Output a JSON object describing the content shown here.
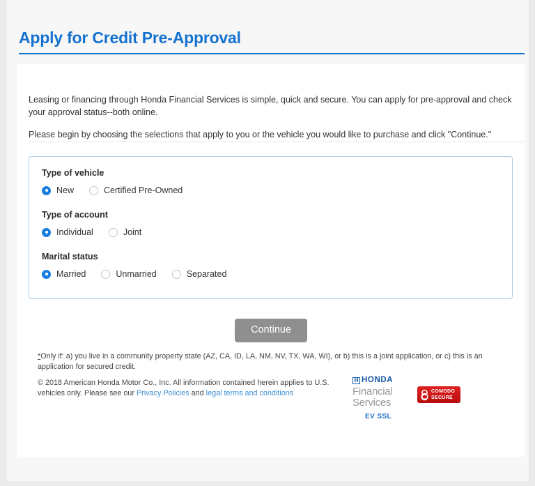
{
  "header": {
    "title": "Apply for Credit Pre-Approval"
  },
  "intro": {
    "paragraph_1": "Leasing or financing through Honda Financial Services is simple, quick and secure. You can apply for pre-approval and check your approval status--both online.",
    "paragraph_2": "Please begin by choosing the selections that apply to you or the vehicle you would like to purchase and click \"Continue.\""
  },
  "form": {
    "groups": [
      {
        "label": "Type of vehicle",
        "name": "type-of-vehicle",
        "options": [
          {
            "label": "New",
            "selected": true
          },
          {
            "label": "Certified Pre-Owned",
            "selected": false
          }
        ]
      },
      {
        "label": "Type of account",
        "name": "type-of-account",
        "options": [
          {
            "label": "Individual",
            "selected": true
          },
          {
            "label": "Joint",
            "selected": false
          }
        ]
      },
      {
        "label": "Marital status",
        "name": "marital-status",
        "options": [
          {
            "label": "Married",
            "selected": true
          },
          {
            "label": "Unmarried",
            "selected": false
          },
          {
            "label": "Separated",
            "selected": false
          }
        ]
      }
    ],
    "continue_label": "Continue"
  },
  "footer": {
    "footnote_star": "*",
    "footnote": "Only if: a) you live in a community property state (AZ, CA, ID, LA, NM, NV, TX, WA, WI), or b) this is a joint application, or c) this is an application for secured credit.",
    "copyright_part_1": "© 2018 American Honda Motor Co., Inc. All information contained herein applies to U.S. vehicles only. Please see our ",
    "privacy_link": "Privacy Policies",
    "copyright_and": " and ",
    "terms_link": "legal terms and conditions",
    "honda_emblem": "H",
    "honda_word": "HONDA",
    "hfs_line_1": "Financial",
    "hfs_line_2": "Services",
    "ev_ssl": "EV SSL",
    "comodo_line_1": "COMODO",
    "comodo_line_2": "SECURE"
  },
  "colors": {
    "brand_blue": "#1571cf",
    "honda_blue": "#1458a8",
    "radio_blue": "#1a7fe0",
    "button_gray": "#8f8f8f",
    "comodo_red": "#e02020",
    "link_blue": "#3c8fd4"
  }
}
